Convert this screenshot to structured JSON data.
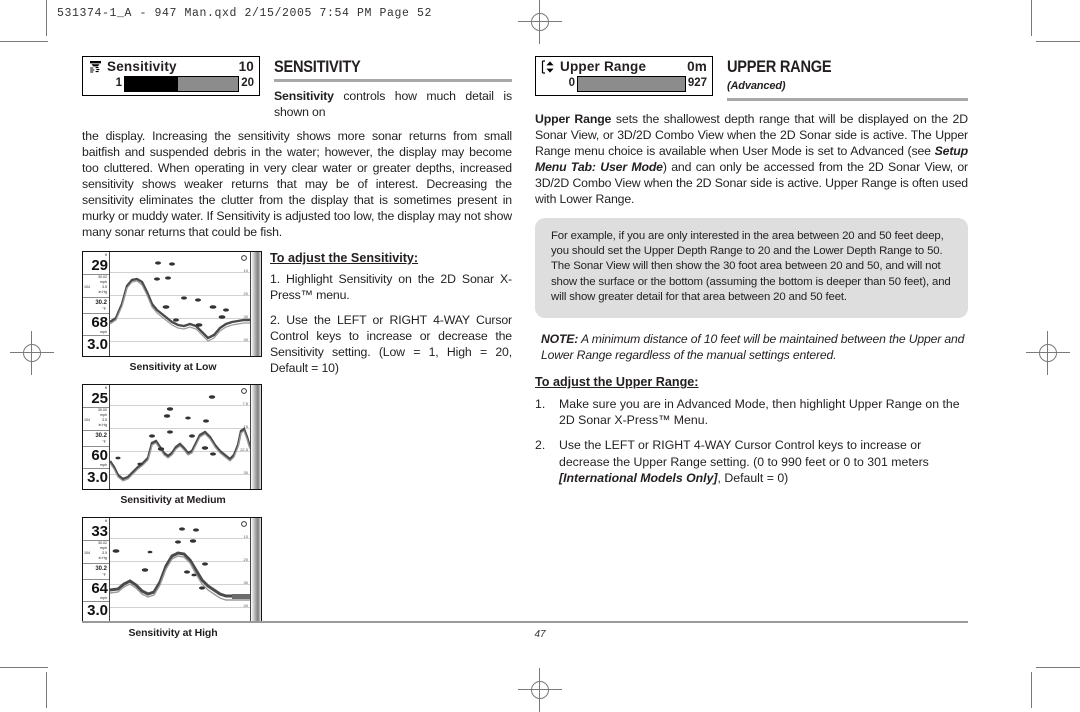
{
  "print_header": "531374-1_A - 947 Man.qxd  2/15/2005  7:54 PM  Page 52",
  "page_number": "47",
  "left_column": {
    "menu_widget": {
      "icon": "sonar-cone-icon",
      "label": "Sensitivity",
      "value": "10",
      "min": "1",
      "max": "20",
      "fill_percent": 47
    },
    "heading": "SENSITIVITY",
    "body": {
      "lead": "Sensitivity",
      "rest": " controls how much detail is shown on the display. Increasing the sensitivity shows more sonar returns from small baitfish and suspended debris in the water; however, the display may become too cluttered. When operating in very clear water or greater depths, increased sensitivity shows weaker returns that may be of interest. Decreasing the sensitivity eliminates the clutter from the display that is sometimes present in murky or muddy water. If Sensitivity is adjusted too low, the display may not show many sonar returns that could be fish."
    },
    "adjust_heading": "To adjust the Sensitivity:",
    "steps": [
      "1. Highlight Sensitivity on the 2D Sonar X-Press™ menu.",
      "2. Use the LEFT or RIGHT 4-WAY Cursor Control keys to increase or decrease the Sensitivity setting. (Low = 1, High = 20, Default = 10)"
    ],
    "figures": [
      {
        "caption": "Sensitivity at Low",
        "depth": "29",
        "unit": "ft",
        "pressure": "30.02",
        "pressure_unit": "in.Hg",
        "heading_deg": "104",
        "speed_small": "3.5",
        "speed_small_unit": "mph",
        "temperature": "30.2",
        "temperature_unit": "°F",
        "second_depth": "68",
        "speed": "3.0",
        "speed_unit": "mph",
        "ticks": [
          "10",
          "20",
          "30",
          "40"
        ]
      },
      {
        "caption": "Sensitivity at Medium",
        "depth": "25",
        "unit": "ft",
        "pressure": "30.00",
        "pressure_unit": "in.Hg",
        "heading_deg": "104",
        "speed_small": "3.5",
        "speed_small_unit": "mph",
        "temperature": "30.2",
        "temperature_unit": "°F",
        "second_depth": "60",
        "speed": "3.0",
        "speed_unit": "mph",
        "ticks": [
          "7.5",
          "15",
          "22.5",
          "30"
        ]
      },
      {
        "caption": "Sensitivity at High",
        "depth": "33",
        "unit": "ft",
        "pressure": "30.02",
        "pressure_unit": "in.Hg",
        "heading_deg": "104",
        "speed_small": "3.5",
        "speed_small_unit": "mph",
        "temperature": "30.2",
        "temperature_unit": "°F",
        "second_depth": "64",
        "speed": "3.0",
        "speed_unit": "mph",
        "ticks": [
          "10",
          "20",
          "30",
          "40"
        ]
      }
    ]
  },
  "right_column": {
    "menu_widget": {
      "icon": "up-down-range-icon",
      "label": "Upper Range",
      "value": "0m",
      "min": "0",
      "max": "927",
      "fill_percent": 88
    },
    "heading": "UPPER RANGE",
    "subheading": "(Advanced)",
    "body_parts": [
      {
        "text": "Upper Range",
        "style": "bold"
      },
      {
        "text": " sets the shallowest depth range that will be displayed on the 2D Sonar View, or 3D/2D Combo View when the 2D Sonar side is active. The Upper Range menu choice is available when User Mode is set to Advanced (see ",
        "style": "normal"
      },
      {
        "text": "Setup Menu Tab: User Mode",
        "style": "bolditalic"
      },
      {
        "text": ") and can only be accessed from the 2D Sonar View, or 3D/2D Combo View when the 2D Sonar side is active. Upper Range is often used with Lower Range.",
        "style": "normal"
      }
    ],
    "example_box": "For example, if you are only interested in the area between 20 and 50 feet deep, you should set the Upper Depth Range to 20 and the Lower Depth Range to 50.  The Sonar View will then show the 30 foot area between 20 and 50, and will not show the surface or the bottom (assuming the bottom is deeper than 50 feet), and will show greater detail for that area between 20 and 50 feet.",
    "note_label": "NOTE:",
    "note_text": " A minimum distance of 10 feet will be maintained between the Upper and Lower Range regardless of the manual settings entered.",
    "adjust_heading": "To adjust the Upper Range:",
    "steps": [
      {
        "num": "1.",
        "parts": [
          {
            "text": "Make sure you are in Advanced Mode, then highlight Upper Range on the 2D Sonar X-Press™ Menu.",
            "style": "normal"
          }
        ]
      },
      {
        "num": "2.",
        "parts": [
          {
            "text": "Use the LEFT or RIGHT 4-WAY Cursor Control keys to increase or decrease the Upper Range setting. (0 to 990 feet or 0 to 301 meters ",
            "style": "normal"
          },
          {
            "text": "[International Models Only]",
            "style": "bolditalic"
          },
          {
            "text": ", Default = 0)",
            "style": "normal"
          }
        ]
      }
    ]
  },
  "colors": {
    "text": "#231f20",
    "rule": "#a8a8a8",
    "example_box_bg": "#dedede",
    "mark": "#7a7a7a"
  }
}
